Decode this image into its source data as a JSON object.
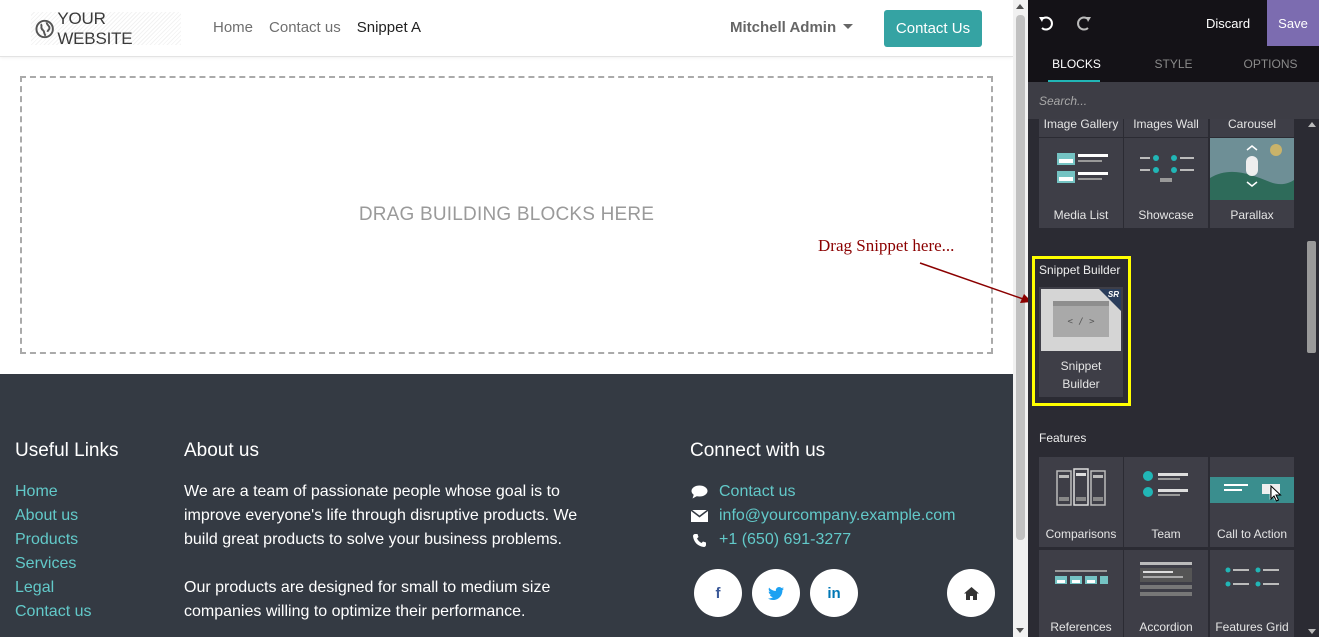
{
  "header": {
    "logo_text": "YOUR WEBSITE",
    "nav": [
      "Home",
      "Contact us",
      "Snippet A"
    ],
    "user_name": "Mitchell Admin",
    "cta_label": "Contact Us"
  },
  "main": {
    "dropzone_text": "DRAG BUILDING BLOCKS HERE",
    "annotation": "Drag Snippet here..."
  },
  "footer": {
    "useful_links_title": "Useful Links",
    "useful_links": [
      "Home",
      "About us",
      "Products",
      "Services",
      "Legal",
      "Contact us"
    ],
    "about_title": "About us",
    "about_p1_lines": [
      "We are a team of passionate people whose goal is to",
      "improve everyone's life through disruptive products. We",
      "build great products to solve your business problems."
    ],
    "about_p2_lines": [
      "Our products are designed for small to medium size",
      "companies willing to optimize their performance."
    ],
    "connect_title": "Connect with us",
    "connect": {
      "contact": "Contact us",
      "email": "info@yourcompany.example.com",
      "phone": "+1 (650) 691-3277"
    },
    "social": [
      "f",
      "in"
    ]
  },
  "editor": {
    "discard_label": "Discard",
    "save_label": "Save",
    "tabs": [
      "BLOCKS",
      "STYLE",
      "OPTIONS"
    ],
    "search_placeholder": "Search...",
    "partial_row": [
      "Image Gallery",
      "Images Wall",
      "Carousel"
    ],
    "structure_row": [
      "Media List",
      "Showcase",
      "Parallax"
    ],
    "snippet_section": "Snippet Builder",
    "snippet_tile_lines": [
      "Snippet",
      "Builder"
    ],
    "snippet_badge": "SR",
    "snippet_code": "< / >",
    "features_section": "Features",
    "features_row1": [
      "Comparisons",
      "Team",
      "Call to Action"
    ],
    "features_row2": [
      "References",
      "Accordion",
      "Features Grid"
    ]
  }
}
